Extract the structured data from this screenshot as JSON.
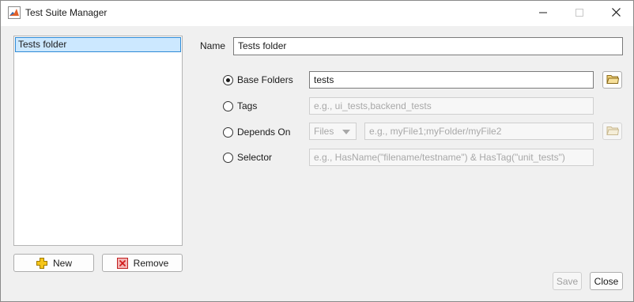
{
  "window": {
    "title": "Test Suite Manager",
    "icon": "matlab-icon"
  },
  "suites": {
    "items": [
      {
        "label": "Tests folder",
        "selected": true
      }
    ]
  },
  "buttons": {
    "new_label": "New",
    "remove_label": "Remove",
    "save_label": "Save",
    "close_label": "Close"
  },
  "form": {
    "name_label": "Name",
    "name_value": "Tests folder",
    "selection_type": "Base Folders",
    "base_folders": {
      "label": "Base Folders",
      "value": "tests"
    },
    "tags": {
      "label": "Tags",
      "placeholder": "e.g., ui_tests,backend_tests"
    },
    "depends_on": {
      "label": "Depends On",
      "type_value": "Files",
      "placeholder": "e.g., myFile1;myFolder/myFile2"
    },
    "selector": {
      "label": "Selector",
      "placeholder": "e.g., HasName(\"filename/testname\") & HasTag(\"unit_tests\")"
    }
  },
  "colors": {
    "selection_bg": "#cce8ff",
    "selection_border": "#2e8bd6",
    "add_icon": "#f5c518",
    "remove_icon": "#e03030"
  }
}
